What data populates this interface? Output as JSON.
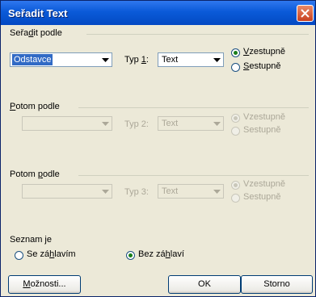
{
  "window": {
    "title": "Seřadit Text",
    "close_icon": "close-icon"
  },
  "sort_by": {
    "label_pre": "Seřa",
    "label_key": "d",
    "label_post": "it podle",
    "field": "Odstavce",
    "type_label_pre": "Typ ",
    "type_label_key": "1",
    "type_label_post": ":",
    "type": "Text",
    "asc_pre": "",
    "asc_key": "V",
    "asc_post": "zestupně",
    "desc_pre": "",
    "desc_key": "S",
    "desc_post": "estupně",
    "selected_order": "Vzestupně"
  },
  "then_by_1": {
    "label_pre": "",
    "label_key": "P",
    "label_post": "otom podle",
    "field": "",
    "type_label": "Typ 2:",
    "type": "Text",
    "asc": "Vzestupně",
    "desc": "Sestupně",
    "selected_order": "Vzestupně"
  },
  "then_by_2": {
    "label_pre": "Potom ",
    "label_key": "p",
    "label_post": "odle",
    "field": "",
    "type_label": "Typ 3:",
    "type": "Text",
    "asc": "Vzestupně",
    "desc": "Sestupně",
    "selected_order": "Vzestupně"
  },
  "list": {
    "label": "Seznam je",
    "with_header_pre": "Se zá",
    "with_header_key": "h",
    "with_header_post": "lavím",
    "no_header_pre": "Bez zá",
    "no_header_key": "h",
    "no_header_post": "laví",
    "selected": "Bez záhlaví"
  },
  "buttons": {
    "options_pre": "",
    "options_key": "M",
    "options_post": "ožnosti...",
    "ok": "OK",
    "cancel": "Storno"
  },
  "colors": {
    "dialog_bg": "#ece9d8",
    "title_bar": "#0a5ad8",
    "selection": "#316ac5",
    "disabled_text": "#aca899",
    "radio_dot": "#1a7e1a",
    "close_button": "#d7542b"
  }
}
